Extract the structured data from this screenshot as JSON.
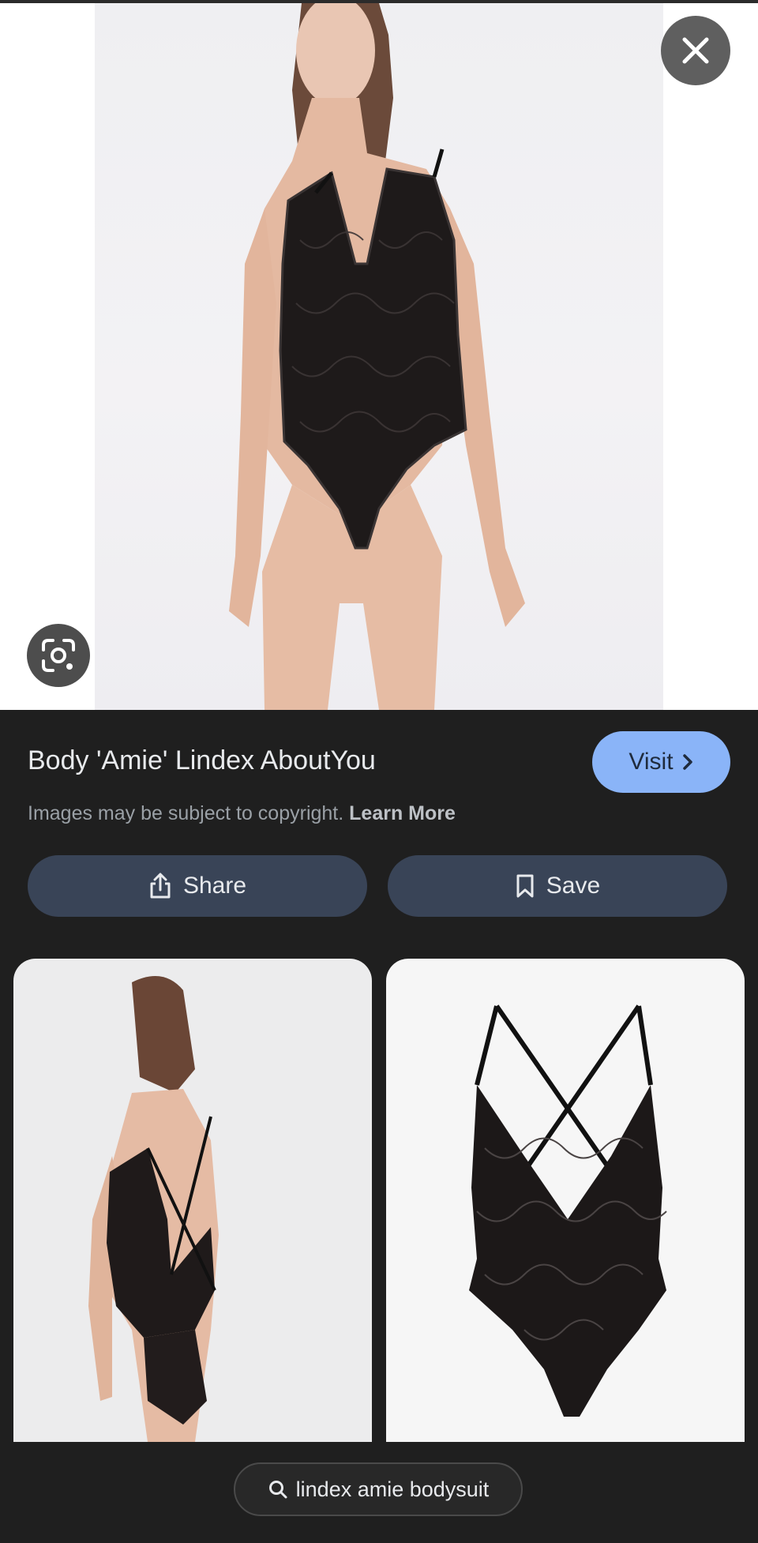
{
  "viewer": {
    "close_icon": "close-icon",
    "lens_icon": "google-lens-icon"
  },
  "result": {
    "title": "Body 'Amie' Lindex AboutYou",
    "visit_label": "Visit",
    "copyright_text": "Images may be subject to copyright.",
    "learn_more_label": "Learn More"
  },
  "actions": {
    "share_label": "Share",
    "save_label": "Save"
  },
  "related": {
    "items": [
      {
        "icon": "product-photo-back-view"
      },
      {
        "icon": "product-photo-flat-bodysuit"
      }
    ]
  },
  "search": {
    "query": "lindex amie bodysuit"
  },
  "colors": {
    "panel_bg": "#1f1f1f",
    "visit_button": "#8ab4f8",
    "action_button": "#394457",
    "title_text": "#e8eaed",
    "muted_text": "#9aa0a6"
  }
}
